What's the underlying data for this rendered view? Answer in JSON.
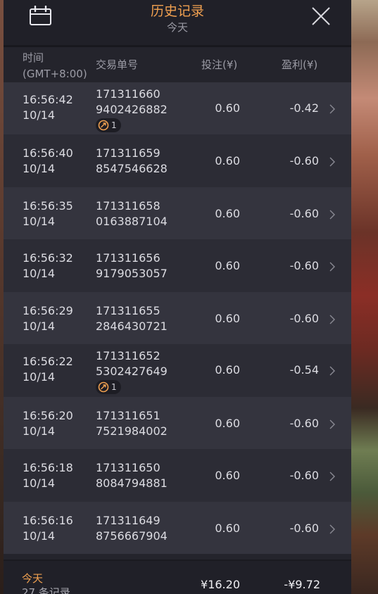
{
  "header": {
    "title": "历史记录",
    "subtitle": "今天",
    "calendar_icon": "calendar-icon",
    "close_icon": "close-icon"
  },
  "columns": {
    "time_line1": "时间",
    "time_line2": "(GMT+8:00)",
    "id": "交易单号",
    "bet": "投注(¥)",
    "profit": "盈利(¥)"
  },
  "rows": [
    {
      "time": "16:56:42",
      "date": "10/14",
      "id1": "171311660",
      "id2": "9402426882",
      "badge": "1",
      "bet": "0.60",
      "profit": "-0.42"
    },
    {
      "time": "16:56:40",
      "date": "10/14",
      "id1": "171311659",
      "id2": "8547546628",
      "badge": null,
      "bet": "0.60",
      "profit": "-0.60"
    },
    {
      "time": "16:56:35",
      "date": "10/14",
      "id1": "171311658",
      "id2": "0163887104",
      "badge": null,
      "bet": "0.60",
      "profit": "-0.60"
    },
    {
      "time": "16:56:32",
      "date": "10/14",
      "id1": "171311656",
      "id2": "9179053057",
      "badge": null,
      "bet": "0.60",
      "profit": "-0.60"
    },
    {
      "time": "16:56:29",
      "date": "10/14",
      "id1": "171311655",
      "id2": "2846430721",
      "badge": null,
      "bet": "0.60",
      "profit": "-0.60"
    },
    {
      "time": "16:56:22",
      "date": "10/14",
      "id1": "171311652",
      "id2": "5302427649",
      "badge": "1",
      "bet": "0.60",
      "profit": "-0.54"
    },
    {
      "time": "16:56:20",
      "date": "10/14",
      "id1": "171311651",
      "id2": "7521984002",
      "badge": null,
      "bet": "0.60",
      "profit": "-0.60"
    },
    {
      "time": "16:56:18",
      "date": "10/14",
      "id1": "171311650",
      "id2": "8084794881",
      "badge": null,
      "bet": "0.60",
      "profit": "-0.60"
    },
    {
      "time": "16:56:16",
      "date": "10/14",
      "id1": "171311649",
      "id2": "8756667904",
      "badge": null,
      "bet": "0.60",
      "profit": "-0.60"
    }
  ],
  "footer": {
    "label": "今天",
    "count": "27 条记录",
    "total_bet": "¥16.20",
    "total_profit": "-¥9.72"
  },
  "colors": {
    "accent": "#f0a050",
    "panel_bg": "#24242c",
    "row_odd": "#34343e",
    "row_even": "#2c2c35"
  }
}
